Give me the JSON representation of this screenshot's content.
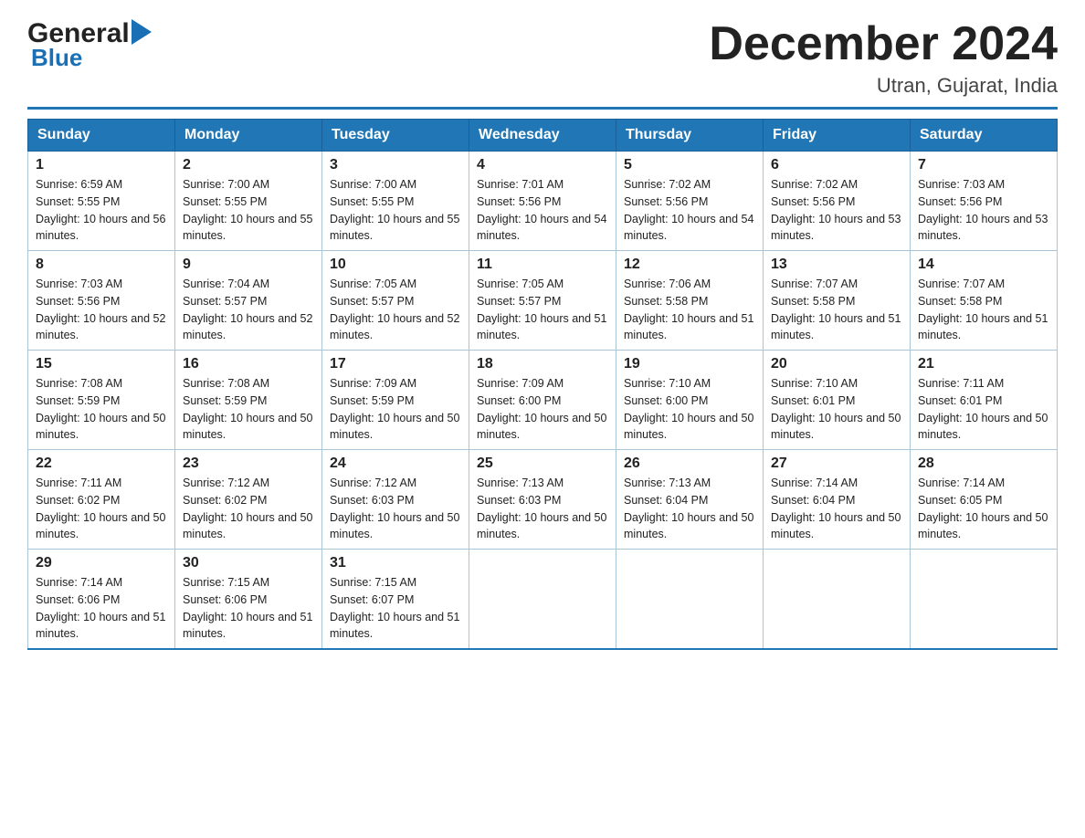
{
  "header": {
    "logo_general": "General",
    "logo_blue": "Blue",
    "month_title": "December 2024",
    "location": "Utran, Gujarat, India"
  },
  "days_of_week": [
    "Sunday",
    "Monday",
    "Tuesday",
    "Wednesday",
    "Thursday",
    "Friday",
    "Saturday"
  ],
  "weeks": [
    [
      {
        "day": "1",
        "sunrise": "6:59 AM",
        "sunset": "5:55 PM",
        "daylight": "10 hours and 56 minutes."
      },
      {
        "day": "2",
        "sunrise": "7:00 AM",
        "sunset": "5:55 PM",
        "daylight": "10 hours and 55 minutes."
      },
      {
        "day": "3",
        "sunrise": "7:00 AM",
        "sunset": "5:55 PM",
        "daylight": "10 hours and 55 minutes."
      },
      {
        "day": "4",
        "sunrise": "7:01 AM",
        "sunset": "5:56 PM",
        "daylight": "10 hours and 54 minutes."
      },
      {
        "day": "5",
        "sunrise": "7:02 AM",
        "sunset": "5:56 PM",
        "daylight": "10 hours and 54 minutes."
      },
      {
        "day": "6",
        "sunrise": "7:02 AM",
        "sunset": "5:56 PM",
        "daylight": "10 hours and 53 minutes."
      },
      {
        "day": "7",
        "sunrise": "7:03 AM",
        "sunset": "5:56 PM",
        "daylight": "10 hours and 53 minutes."
      }
    ],
    [
      {
        "day": "8",
        "sunrise": "7:03 AM",
        "sunset": "5:56 PM",
        "daylight": "10 hours and 52 minutes."
      },
      {
        "day": "9",
        "sunrise": "7:04 AM",
        "sunset": "5:57 PM",
        "daylight": "10 hours and 52 minutes."
      },
      {
        "day": "10",
        "sunrise": "7:05 AM",
        "sunset": "5:57 PM",
        "daylight": "10 hours and 52 minutes."
      },
      {
        "day": "11",
        "sunrise": "7:05 AM",
        "sunset": "5:57 PM",
        "daylight": "10 hours and 51 minutes."
      },
      {
        "day": "12",
        "sunrise": "7:06 AM",
        "sunset": "5:58 PM",
        "daylight": "10 hours and 51 minutes."
      },
      {
        "day": "13",
        "sunrise": "7:07 AM",
        "sunset": "5:58 PM",
        "daylight": "10 hours and 51 minutes."
      },
      {
        "day": "14",
        "sunrise": "7:07 AM",
        "sunset": "5:58 PM",
        "daylight": "10 hours and 51 minutes."
      }
    ],
    [
      {
        "day": "15",
        "sunrise": "7:08 AM",
        "sunset": "5:59 PM",
        "daylight": "10 hours and 50 minutes."
      },
      {
        "day": "16",
        "sunrise": "7:08 AM",
        "sunset": "5:59 PM",
        "daylight": "10 hours and 50 minutes."
      },
      {
        "day": "17",
        "sunrise": "7:09 AM",
        "sunset": "5:59 PM",
        "daylight": "10 hours and 50 minutes."
      },
      {
        "day": "18",
        "sunrise": "7:09 AM",
        "sunset": "6:00 PM",
        "daylight": "10 hours and 50 minutes."
      },
      {
        "day": "19",
        "sunrise": "7:10 AM",
        "sunset": "6:00 PM",
        "daylight": "10 hours and 50 minutes."
      },
      {
        "day": "20",
        "sunrise": "7:10 AM",
        "sunset": "6:01 PM",
        "daylight": "10 hours and 50 minutes."
      },
      {
        "day": "21",
        "sunrise": "7:11 AM",
        "sunset": "6:01 PM",
        "daylight": "10 hours and 50 minutes."
      }
    ],
    [
      {
        "day": "22",
        "sunrise": "7:11 AM",
        "sunset": "6:02 PM",
        "daylight": "10 hours and 50 minutes."
      },
      {
        "day": "23",
        "sunrise": "7:12 AM",
        "sunset": "6:02 PM",
        "daylight": "10 hours and 50 minutes."
      },
      {
        "day": "24",
        "sunrise": "7:12 AM",
        "sunset": "6:03 PM",
        "daylight": "10 hours and 50 minutes."
      },
      {
        "day": "25",
        "sunrise": "7:13 AM",
        "sunset": "6:03 PM",
        "daylight": "10 hours and 50 minutes."
      },
      {
        "day": "26",
        "sunrise": "7:13 AM",
        "sunset": "6:04 PM",
        "daylight": "10 hours and 50 minutes."
      },
      {
        "day": "27",
        "sunrise": "7:14 AM",
        "sunset": "6:04 PM",
        "daylight": "10 hours and 50 minutes."
      },
      {
        "day": "28",
        "sunrise": "7:14 AM",
        "sunset": "6:05 PM",
        "daylight": "10 hours and 50 minutes."
      }
    ],
    [
      {
        "day": "29",
        "sunrise": "7:14 AM",
        "sunset": "6:06 PM",
        "daylight": "10 hours and 51 minutes."
      },
      {
        "day": "30",
        "sunrise": "7:15 AM",
        "sunset": "6:06 PM",
        "daylight": "10 hours and 51 minutes."
      },
      {
        "day": "31",
        "sunrise": "7:15 AM",
        "sunset": "6:07 PM",
        "daylight": "10 hours and 51 minutes."
      },
      null,
      null,
      null,
      null
    ]
  ]
}
